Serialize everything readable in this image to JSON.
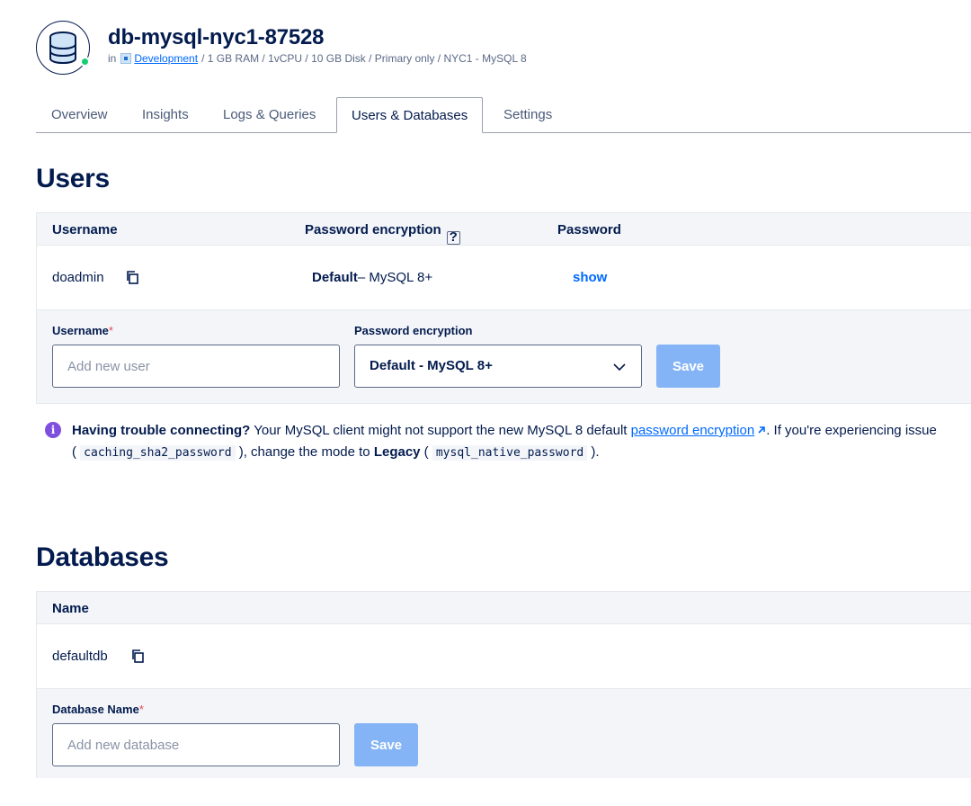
{
  "header": {
    "title": "db-mysql-nyc1-87528",
    "meta_prefix": "in",
    "project_link": "Development",
    "meta_specs": "/ 1 GB RAM / 1vCPU / 10 GB Disk / Primary only / NYC1 - MySQL 8",
    "icon": "database-icon",
    "status_color": "#15cd72"
  },
  "tabs": [
    {
      "label": "Overview"
    },
    {
      "label": "Insights"
    },
    {
      "label": "Logs & Queries"
    },
    {
      "label": "Users & Databases",
      "active": true
    },
    {
      "label": "Settings"
    }
  ],
  "users": {
    "title": "Users",
    "columns": [
      "Username",
      "Password encryption",
      "Password"
    ],
    "rows": [
      {
        "username": "doadmin",
        "encryption_bold": "Default",
        "encryption_rest": "– MySQL 8+",
        "password_action": "show"
      }
    ],
    "form": {
      "username_label": "Username",
      "required_mark": "*",
      "username_placeholder": "Add new user",
      "encryption_label": "Password encryption",
      "encryption_value": "Default - MySQL 8+",
      "save_label": "Save"
    }
  },
  "notice": {
    "bold_lead": "Having trouble connecting?",
    "text1": " Your MySQL client might not support the new MySQL 8 default ",
    "link": "password encryption",
    "text2": ". If you're experiencing issue",
    "paren_open": "( ",
    "code1": "caching_sha2_password",
    "text3": " ), change the mode to ",
    "legacy": "Legacy",
    "paren_open2": " ( ",
    "code2": "mysql_native_password",
    "text4": " )."
  },
  "databases": {
    "title": "Databases",
    "columns": [
      "Name"
    ],
    "rows": [
      {
        "name": "defaultdb"
      }
    ],
    "form": {
      "name_label": "Database Name",
      "required_mark": "*",
      "name_placeholder": "Add new database",
      "save_label": "Save"
    }
  },
  "colors": {
    "primary": "#0069ff",
    "text": "#031b4e",
    "save_disabled": "#85b4f6",
    "info": "#7f4fe0"
  }
}
